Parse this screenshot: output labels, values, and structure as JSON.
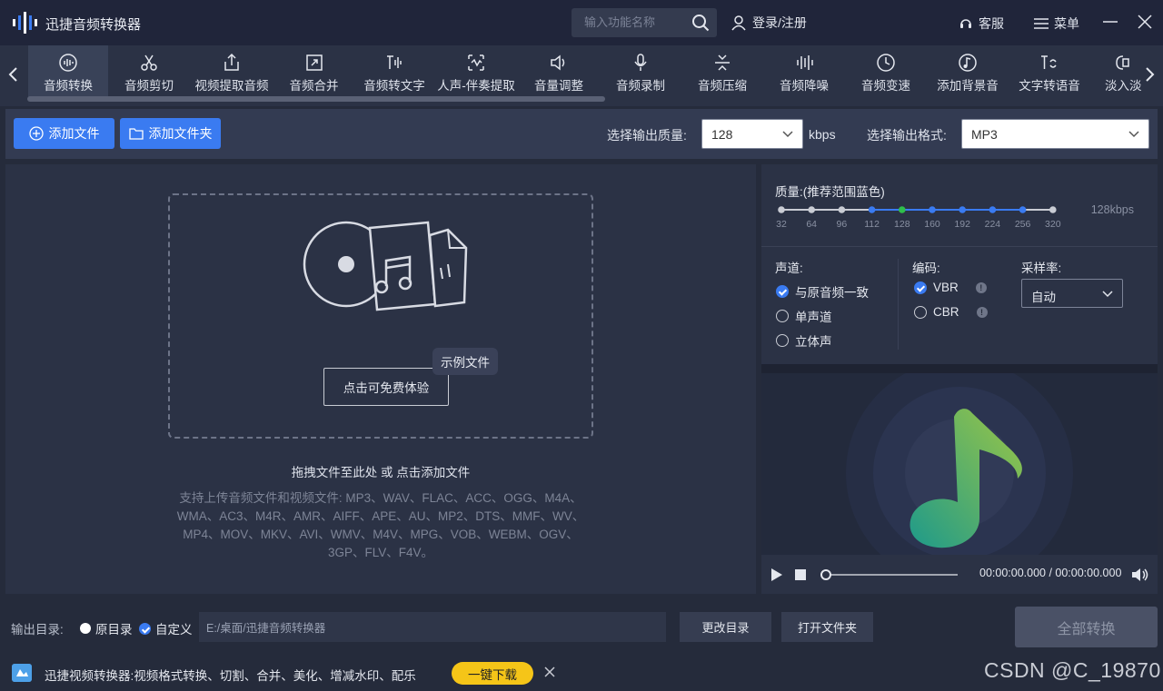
{
  "app": {
    "title": "迅捷音频转换器"
  },
  "header": {
    "search_placeholder": "输入功能名称",
    "login_label": "登录/注册",
    "service_label": "客服",
    "menu_label": "菜单"
  },
  "tools": [
    {
      "label": "音频转换",
      "icon": "audio-convert-icon",
      "active": true
    },
    {
      "label": "音频剪切",
      "icon": "scissors-icon"
    },
    {
      "label": "视频提取音频",
      "icon": "export-icon"
    },
    {
      "label": "音频合并",
      "icon": "merge-icon"
    },
    {
      "label": "音频转文字",
      "icon": "speech-to-text-icon"
    },
    {
      "label": "人声-伴奏提取",
      "icon": "vocal-extract-icon"
    },
    {
      "label": "音量调整",
      "icon": "volume-icon"
    },
    {
      "label": "音频录制",
      "icon": "microphone-icon"
    },
    {
      "label": "音频压缩",
      "icon": "compress-icon"
    },
    {
      "label": "音频降噪",
      "icon": "denoise-icon"
    },
    {
      "label": "音频变速",
      "icon": "speed-icon"
    },
    {
      "label": "添加背景音",
      "icon": "background-music-icon"
    },
    {
      "label": "文字转语音",
      "icon": "text-to-speech-icon"
    },
    {
      "label": "淡入淡",
      "icon": "fade-icon"
    }
  ],
  "actions": {
    "add_file": "添加文件",
    "add_folder": "添加文件夹",
    "quality_label": "选择输出质量:",
    "quality_value": "128",
    "quality_unit": "kbps",
    "format_label": "选择输出格式:",
    "format_value": "MP3"
  },
  "dropzone": {
    "try_label": "点击可免费体验",
    "sample_tip": "示例文件",
    "hint": "拖拽文件至此处 或 点击添加文件",
    "formats": "支持上传音频文件和视频文件: MP3、WAV、FLAC、ACC、OGG、M4A、WMA、AC3、M4R、AMR、AIFF、APE、AU、MP2、DTS、MMF、WV、MP4、MOV、MKV、AVI、WMV、M4V、MPG、VOB、WEBM、OGV、3GP、FLV、F4V。"
  },
  "quality_panel": {
    "title": "质量:(推荐范围蓝色)",
    "ticks": [
      "32",
      "64",
      "96",
      "112",
      "128",
      "160",
      "192",
      "224",
      "256",
      "320"
    ],
    "current": "128kbps",
    "channel_title": "声道:",
    "channels": [
      "与原音频一致",
      "单声道",
      "立体声"
    ],
    "encoding_title": "编码:",
    "encodings": [
      "VBR",
      "CBR"
    ],
    "sample_title": "采样率:",
    "sample_value": "自动",
    "colors": {
      "recommended": "#3a7bf1",
      "selected": "#2fbf4b",
      "normal": "#c9ccd4"
    }
  },
  "player": {
    "time": "00:00:00.000 / 00:00:00.000"
  },
  "output": {
    "label": "输出目录:",
    "original": "原目录",
    "custom": "自定义",
    "path": "E:/桌面/迅捷音频转换器",
    "change_dir": "更改目录",
    "open_folder": "打开文件夹",
    "convert_all": "全部转换"
  },
  "ad": {
    "text": "迅捷视频转换器:视频格式转换、切割、合并、美化、增减水印、配乐",
    "download": "一键下载"
  },
  "watermark": "CSDN @C_19870"
}
